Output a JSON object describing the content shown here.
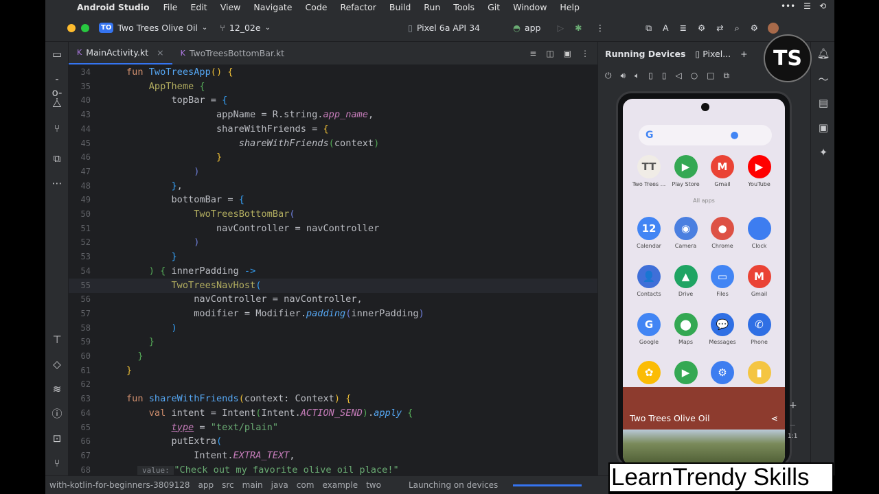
{
  "menubar": {
    "app_name": "Android Studio",
    "items": [
      "File",
      "Edit",
      "View",
      "Navigate",
      "Code",
      "Refactor",
      "Build",
      "Run",
      "Tools",
      "Git",
      "Window",
      "Help"
    ]
  },
  "titlebar": {
    "project_badge": "TO",
    "project_name": "Two Trees Olive Oil",
    "branch": "12_02e",
    "device": "Pixel 6a API 34",
    "run_config": "app"
  },
  "tabs": [
    {
      "label": "MainActivity.kt",
      "active": true
    },
    {
      "label": "TwoTreesBottomBar.kt",
      "active": false
    }
  ],
  "editor": {
    "lines": [
      {
        "n": "34",
        "html": "<span class='kw'>fun </span><span class='fn'>TwoTreesApp</span><span class='br1'>()</span> <span class='br1'>{</span>"
      },
      {
        "n": "35",
        "html": "    <span class='ann'>AppTheme</span> <span class='br2'>{</span>"
      },
      {
        "n": "40",
        "html": "        topBar = <span class='br3'>{</span>"
      },
      {
        "n": "43",
        "html": "                appName = R.string.<span class='prop it'>app_name</span>,"
      },
      {
        "n": "44",
        "html": "                shareWithFriends = <span class='br1'>{</span>"
      },
      {
        "n": "45",
        "html": "                    <span class='it'>shareWithFriends</span><span class='br2'>(</span>context<span class='br2'>)</span>"
      },
      {
        "n": "46",
        "html": "                <span class='br1'>}</span>"
      },
      {
        "n": "47",
        "html": "            <span class='br4'>)</span>"
      },
      {
        "n": "48",
        "html": "        <span class='br3'>}</span>,"
      },
      {
        "n": "49",
        "html": "        bottomBar = <span class='br3'>{</span>"
      },
      {
        "n": "50",
        "html": "            <span class='ann'>TwoTreesBottomBar</span><span class='br4'>(</span>"
      },
      {
        "n": "51",
        "html": "                navController = navController"
      },
      {
        "n": "52",
        "html": "            <span class='br4'>)</span>"
      },
      {
        "n": "53",
        "html": "        <span class='br3'>}</span>"
      },
      {
        "n": "54",
        "html": "    <span class='br2'>)</span> <span class='br2'>{</span> innerPadding <span class='br3'>-></span>"
      },
      {
        "n": "55",
        "html": "        <span class='ann'>TwoTreesNavHost</span><span class='br3'>(</span>"
      },
      {
        "n": "56",
        "html": "            navController = navController,"
      },
      {
        "n": "57",
        "html": "            modifier = Modifier.<span class='fn it'>padding</span><span class='br4'>(</span>innerPadding<span class='br4'>)</span>"
      },
      {
        "n": "58",
        "html": "        <span class='br3'>)</span>"
      },
      {
        "n": "59",
        "html": "    <span class='br2'>}</span>"
      },
      {
        "n": "60",
        "html": "  <span class='br2'>}</span>"
      },
      {
        "n": "61",
        "html": "<span class='br1'>}</span>"
      },
      {
        "n": "62",
        "html": ""
      },
      {
        "n": "63",
        "html": "<span class='kw'>fun </span><span class='fn'>shareWithFriends</span><span class='br1'>(</span>context: Context<span class='br1'>)</span> <span class='br1'>{</span>"
      },
      {
        "n": "64",
        "html": "    <span class='kw'>val </span>intent = Intent<span class='br2'>(</span>Intent.<span class='prop it'>ACTION_SEND</span><span class='br2'>)</span>.<span class='fn it'>apply</span> <span class='br2'>{</span>"
      },
      {
        "n": "65",
        "html": "        <span class='prop it' style='text-decoration:underline'>type</span> = <span class='str'>\"text/plain\"</span>"
      },
      {
        "n": "66",
        "html": "        putExtra<span class='br3'>(</span>"
      },
      {
        "n": "67",
        "html": "            Intent.<span class='prop it'>EXTRA_TEXT</span>,"
      },
      {
        "n": "68",
        "html": "  <span class='grey' style='background:#2b2d30;font-size:11px'> value: </span><span class='str'>\"Check out my favorite olive oil place!\"</span>"
      }
    ]
  },
  "statusbar": {
    "path": [
      "with-kotlin-for-beginners-3809128",
      "app",
      "src",
      "main",
      "java",
      "com",
      "example",
      "two"
    ],
    "status": "Launching on devices"
  },
  "devpanel": {
    "title": "Running Devices",
    "tab": "Pixel..."
  },
  "phone": {
    "apps_row1": [
      {
        "label": "Two Trees ...",
        "glyph": "TT",
        "color": "#f0ece6"
      },
      {
        "label": "Play Store",
        "glyph": "▶",
        "color": "#34a853"
      },
      {
        "label": "Gmail",
        "glyph": "M",
        "color": "#ea4335"
      },
      {
        "label": "YouTube",
        "glyph": "▶",
        "color": "#ff0000"
      }
    ],
    "all_apps": "All apps",
    "apps_row2": [
      {
        "label": "Calendar",
        "glyph": "12",
        "color": "#4285f4"
      },
      {
        "label": "Camera",
        "glyph": "◉",
        "color": "#4a7fe0"
      },
      {
        "label": "Chrome",
        "glyph": "●",
        "color": "#dd5144"
      },
      {
        "label": "Clock",
        "glyph": "",
        "color": "#3d7df0"
      }
    ],
    "apps_row3": [
      {
        "label": "Contacts",
        "glyph": "👤",
        "color": "#3f6fd8"
      },
      {
        "label": "Drive",
        "glyph": "▲",
        "color": "#1fa463"
      },
      {
        "label": "Files",
        "glyph": "▭",
        "color": "#4285f4"
      },
      {
        "label": "Gmail",
        "glyph": "M",
        "color": "#ea4335"
      }
    ],
    "apps_row4": [
      {
        "label": "Google",
        "glyph": "G",
        "color": "#4285f4"
      },
      {
        "label": "Maps",
        "glyph": "⬤",
        "color": "#34a853"
      },
      {
        "label": "Messages",
        "glyph": "💬",
        "color": "#2f6fe4"
      },
      {
        "label": "Phone",
        "glyph": "✆",
        "color": "#2f6fe4"
      }
    ],
    "apps_row5": [
      {
        "label": "",
        "glyph": "✿",
        "color": "#fbbc05"
      },
      {
        "label": "",
        "glyph": "▶",
        "color": "#34a853"
      },
      {
        "label": "",
        "glyph": "⚙",
        "color": "#3d7df0"
      },
      {
        "label": "",
        "glyph": "▮",
        "color": "#f4c542"
      }
    ],
    "banner_title": "Two Trees Olive Oil"
  },
  "watermark": "LearnTrendy Skills",
  "logo": "TS"
}
